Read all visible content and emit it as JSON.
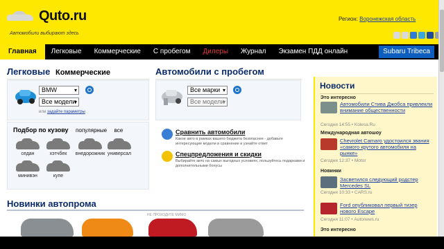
{
  "header": {
    "logo": "Quto.ru",
    "tagline": "Автомобили выбирают здесь",
    "region_label": "Регион:",
    "region_value": "Воронежская область"
  },
  "nav": [
    {
      "label": "Главная"
    },
    {
      "label": "Легковые"
    },
    {
      "label": "Коммерческие"
    },
    {
      "label": "С пробегом"
    },
    {
      "label": "Дилеры"
    },
    {
      "label": "Журнал"
    },
    {
      "label": "Экзамен ПДД онлайн"
    },
    {
      "label": "Subaru Tribeca"
    }
  ],
  "left": {
    "tab_active": "Легковые",
    "tab_other": "Коммерческие",
    "brand_select": "BMW",
    "model_select": "Все модели",
    "params_prefix": "или",
    "params_link": "задайте параметры",
    "body_heading": "Подбор по кузову",
    "body_popular": "популярные",
    "body_all": "все",
    "body_types": [
      "седан",
      "хэтчбек",
      "внедорожник",
      "универсал",
      "минивэн",
      "купе"
    ]
  },
  "middle": {
    "title": "Автомобили с пробегом",
    "brand_select": "Все марки",
    "model_select": "Все модели",
    "features": [
      {
        "title": "Сравнить автомобили",
        "desc": "Какое авто в рамках вашего бюджета безопаснее - добавьте интересующие модели в сравнение и узнайте ответ"
      },
      {
        "title": "Спецпредложения и скидки",
        "desc": "Выбирайте авто на самых выгодных условиях, пользуйтесь подарками и дополнительными бонусы"
      }
    ]
  },
  "news": {
    "title": "Новости",
    "items": [
      {
        "category": "Это интересно",
        "text": "Автомобили Стива Джобса привлекли внимание общественности",
        "meta": "Сегодня 14:55 • Kolesa.Ru"
      },
      {
        "category": "Международная автошоу",
        "text": "Chevrolet Camaro удостоился звания «самого крутого автомобиля на рынке»",
        "meta": "Сегодня 12:37 • Motor"
      },
      {
        "category": "Новинки",
        "text": "Засветился следующий родстер Mercedes SL",
        "meta": "Сегодня 10:33 • CARS.ru"
      },
      {
        "category": "",
        "text": "Ford опубликовал первый тизер нового Escape",
        "meta": "Сегодня 11:07 • Autonews.ru"
      },
      {
        "category": "Это интересно",
        "text": "",
        "meta": ""
      }
    ]
  },
  "bottom": {
    "title": "Новинки автопрома",
    "ad_label": "НЕ ПРОХОДИТЕ МИМО"
  },
  "colors": {
    "header_yellow": "#ffe800",
    "nav_black": "#000000",
    "title_blue": "#0a2a6a",
    "link_blue": "#1a3ca0",
    "promo_blue": "#0e5ec0",
    "news_bg": "#fff7c9"
  }
}
